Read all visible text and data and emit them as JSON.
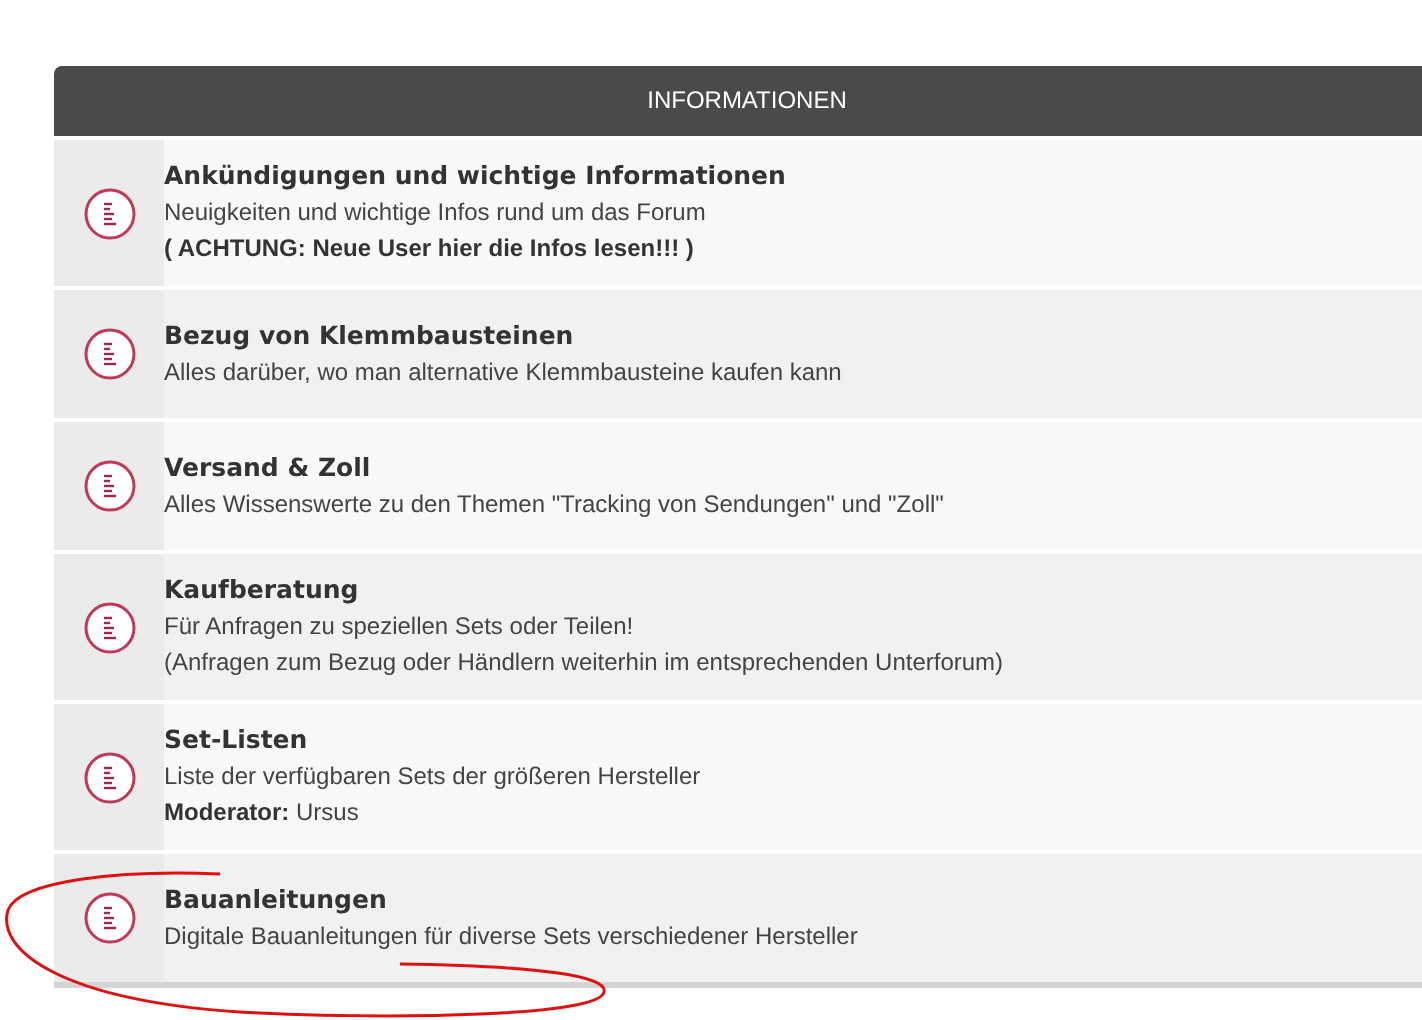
{
  "category": {
    "title": "INFORMATIONEN"
  },
  "forums": [
    {
      "title": "Ankündigungen und wichtige Informationen",
      "lines": [
        {
          "kind": "text",
          "text": "Neuigkeiten und wichtige Infos rund um das Forum"
        },
        {
          "kind": "notice",
          "text": "( ACHTUNG: Neue User hier die Infos lesen!!! )"
        }
      ]
    },
    {
      "title": "Bezug von Klemmbausteinen",
      "lines": [
        {
          "kind": "text",
          "text": "Alles darüber, wo man alternative Klemmbausteine kaufen kann"
        }
      ]
    },
    {
      "title": "Versand & Zoll",
      "lines": [
        {
          "kind": "text",
          "text": "Alles Wissenswerte zu den Themen \"Tracking von Sendungen\" und \"Zoll\""
        }
      ]
    },
    {
      "title": "Kaufberatung",
      "lines": [
        {
          "kind": "text",
          "text": "Für Anfragen zu speziellen Sets oder Teilen!"
        },
        {
          "kind": "text",
          "text": "(Anfragen zum Bezug oder Händlern weiterhin im entsprechenden Unterforum)"
        }
      ]
    },
    {
      "title": "Set-Listen",
      "lines": [
        {
          "kind": "text",
          "text": "Liste der verfügbaren Sets der größeren Hersteller"
        },
        {
          "kind": "text",
          "text": "**Moderator:** Ursus"
        }
      ]
    },
    {
      "title": "Bauanleitungen",
      "lines": [
        {
          "kind": "text",
          "text": "Digitale Bauanleitungen für diverse Sets verschiedener Hersteller"
        }
      ]
    }
  ]
}
